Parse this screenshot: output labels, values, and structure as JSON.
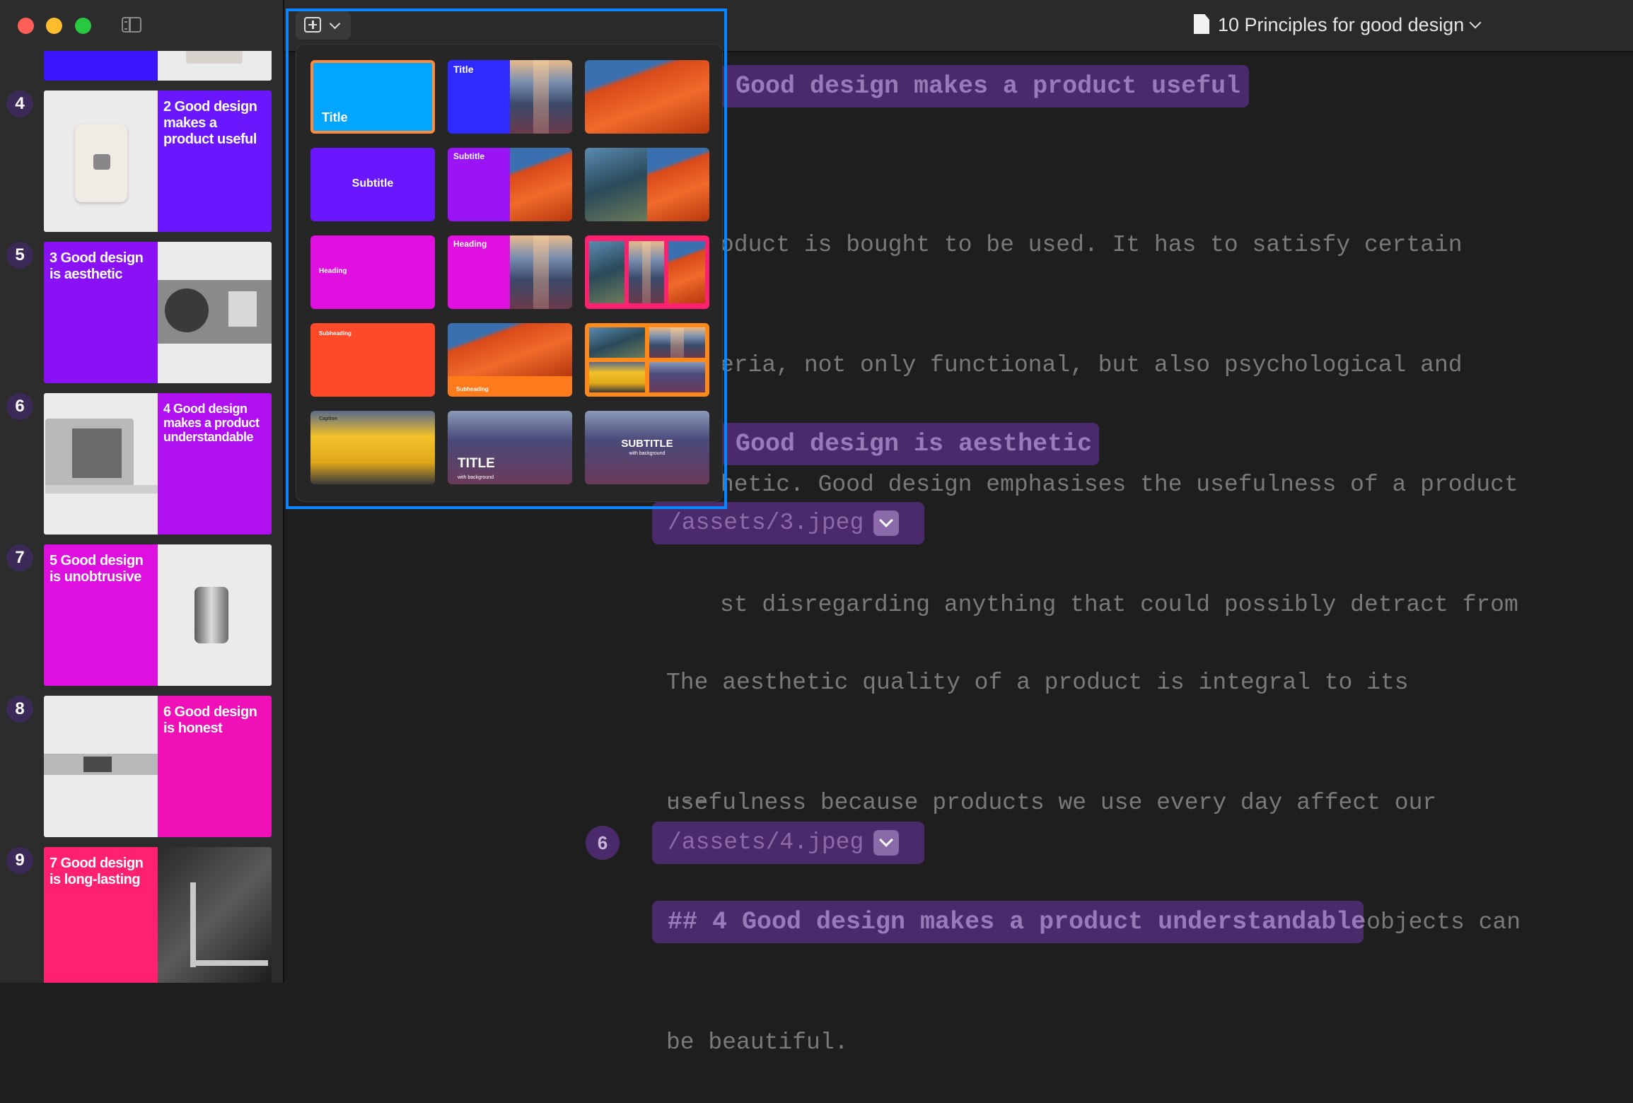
{
  "window": {
    "doc_title": "10 Principles for good design"
  },
  "sidebar": {
    "slides": [
      {
        "number": "4",
        "text": "2 Good design makes a product useful",
        "text_side": "right",
        "color": "#6a16ff"
      },
      {
        "number": "5",
        "text": "3 Good design is aesthetic",
        "text_side": "left",
        "color": "#8a10f5"
      },
      {
        "number": "6",
        "text": "4 Good design makes a product understandable",
        "text_side": "right",
        "color": "#b010f0"
      },
      {
        "number": "7",
        "text": "5 Good design is unobtrusive",
        "text_side": "left",
        "color": "#dd10e0"
      },
      {
        "number": "8",
        "text": "6 Good design is honest",
        "text_side": "right",
        "color": "#f010b8"
      },
      {
        "number": "9",
        "text": "7 Good design is long-lasting",
        "text_side": "left",
        "color": "#ff2070"
      }
    ]
  },
  "editor": {
    "heading_useful": "Good design makes a product useful",
    "para_useful": [
      "oduct is bought to be used. It has to satisfy certain",
      "eria, not only functional, but also psychological and",
      "hetic. Good design emphasises the usefulness of a product",
      "st disregarding anything that could possibly detract from"
    ],
    "heading_aesthetic": "Good design is aesthetic",
    "asset_3": "/assets/3.jpeg",
    "para_aesthetic": [
      "The aesthetic quality of a product is integral to its",
      "usefulness because products we use every day affect our",
      "person and our well-being. But only well-executed objects can",
      "be beautiful."
    ],
    "separator": "---",
    "line_badge": "6",
    "asset_4": "/assets/4.jpeg",
    "heading_understandable": "## 4 Good design makes a product understandable"
  },
  "layout_picker": {
    "labels": {
      "title": "Title",
      "subtitle": "Subtitle",
      "heading": "Heading",
      "subheading": "Subheading",
      "caption": "Caption",
      "title_bg": "TITLE",
      "subtitle_bg": "SUBTITLE",
      "with_background": "with background"
    },
    "colors": {
      "cyan": "#00a6ff",
      "blue": "#2f2bff",
      "purple": "#6a16ff",
      "violet": "#9a14f5",
      "magenta": "#e010e0",
      "red": "#ff4a2a",
      "orange": "#ff7a1a",
      "selection": "#ff8a3a"
    }
  }
}
